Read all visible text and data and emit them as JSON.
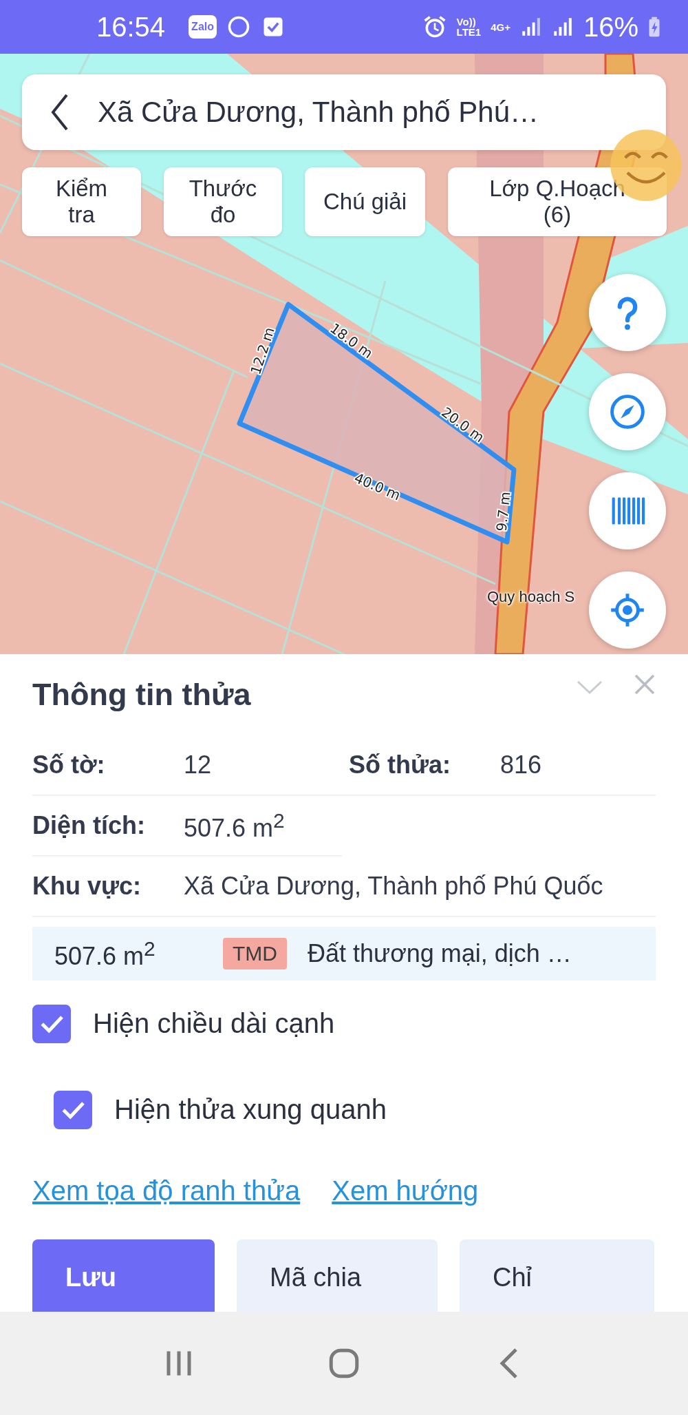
{
  "status_bar": {
    "time": "16:54",
    "app_badge": "Zalo",
    "volte": "Vo))",
    "lte": "LTE1",
    "network": "4G+",
    "battery": "16%"
  },
  "search": {
    "value": "Xã Cửa Dương, Thành phố Phú…"
  },
  "map_tools": [
    {
      "label": "Kiểm tra"
    },
    {
      "label": "Thước đo"
    },
    {
      "label": "Chú giải"
    },
    {
      "label": "Lớp Q.Hoạch (6)"
    }
  ],
  "map": {
    "edges": [
      {
        "label": "12.2 m"
      },
      {
        "label": "18.0 m"
      },
      {
        "label": "20.0 m"
      },
      {
        "label": "40.0 m"
      },
      {
        "label": "9.7 m"
      }
    ],
    "layer_label": "Quy hoạch S"
  },
  "panel": {
    "title": "Thông tin thửa",
    "fields": [
      {
        "label": "Số tờ:",
        "value": "12"
      },
      {
        "label": "Số thửa:",
        "value": "816"
      },
      {
        "label": "Diện tích:",
        "value": "507.6 m$^{2}$"
      },
      {
        "label": "Khu vực:",
        "value": "Xã Cửa Dương, Thành phố Phú Quốc"
      }
    ],
    "land_use": {
      "area": "507.6 m$^{2}$",
      "code": "TMD",
      "description": "Đất thương mại, dịch …"
    },
    "options": [
      {
        "label": "Hiện chiều dài cạnh",
        "checked": true
      },
      {
        "label": "Hiện thửa xung quanh",
        "checked": true
      }
    ],
    "links": [
      "Xem tọa độ ranh thửa",
      "Xem hướng"
    ],
    "actions": [
      {
        "label": "Lưu",
        "selected": true
      },
      {
        "label": "Mã chia",
        "selected": false
      },
      {
        "label": "Chỉ",
        "selected": false
      }
    ]
  }
}
